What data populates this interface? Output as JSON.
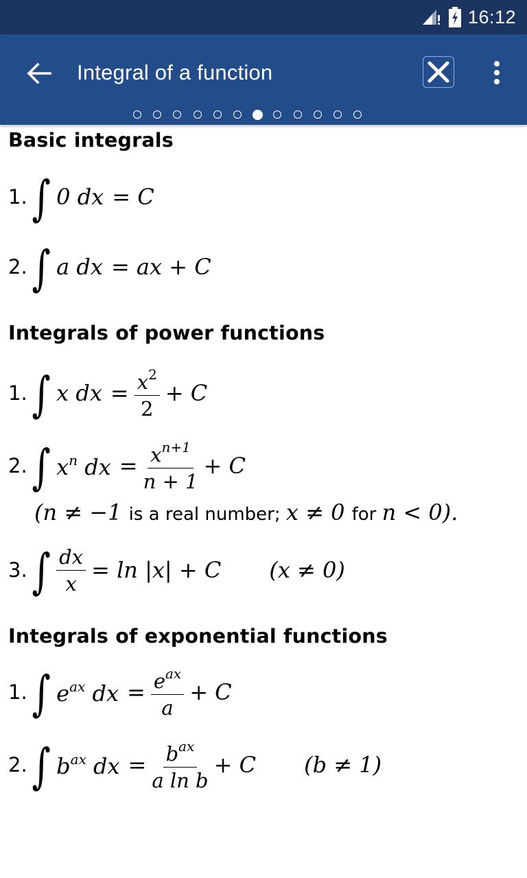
{
  "status_bar": {
    "time": "16:12",
    "icons": [
      "signal-no-data-icon",
      "battery-charging-icon"
    ]
  },
  "app_bar": {
    "title": "Integral of a function",
    "back_icon": "arrow-left-icon",
    "close_icon": "close-x-icon",
    "more_icon": "more-vertical-icon",
    "colors": {
      "status_bar": "#1b3560",
      "app_bar": "#234d8a"
    }
  },
  "pager": {
    "total_pages": 12,
    "current_page": 7
  },
  "sections": [
    {
      "heading": "Basic integrals",
      "formulas": [
        {
          "num": "1.",
          "integrand": "0 dx",
          "result": "= C"
        },
        {
          "num": "2.",
          "integrand": "a dx",
          "result": "= ax + C"
        }
      ]
    },
    {
      "heading": "Integrals of power functions",
      "formulas": [
        {
          "num": "1.",
          "integrand": "x dx",
          "eq": "=",
          "frac_num": "x",
          "frac_num_sup": "2",
          "frac_den": "2",
          "tail": "+ C"
        },
        {
          "num": "2.",
          "integrand": "x",
          "integrand_sup": "n",
          "integrand_tail": " dx",
          "eq": "=",
          "frac_num": "x",
          "frac_num_sup": "n+1",
          "frac_den": "n + 1",
          "tail": "+ C",
          "note": {
            "p1": "(n ≠ −1 ",
            "t1": "is a real number; ",
            "p2": "x ≠ 0 ",
            "t2": "for ",
            "p3": "n < 0)."
          }
        },
        {
          "num": "3.",
          "frac_num": "dx",
          "frac_den": "x",
          "result": "= ln |x| + C",
          "condition": "(x ≠ 0)"
        }
      ]
    },
    {
      "heading": "Integrals of exponential functions",
      "formulas": [
        {
          "num": "1.",
          "integrand": "e",
          "integrand_sup": "ax",
          "integrand_tail": " dx",
          "eq": "=",
          "frac_num": "e",
          "frac_num_sup": "ax",
          "frac_den": "a",
          "tail": "+ C"
        },
        {
          "num": "2.",
          "integrand": "b",
          "integrand_sup": "ax",
          "integrand_tail": " dx",
          "eq": "=",
          "frac_num": "b",
          "frac_num_sup": "ax",
          "frac_den": "a ln b",
          "tail": "+ C",
          "condition": "(b ≠ 1)"
        }
      ]
    }
  ]
}
